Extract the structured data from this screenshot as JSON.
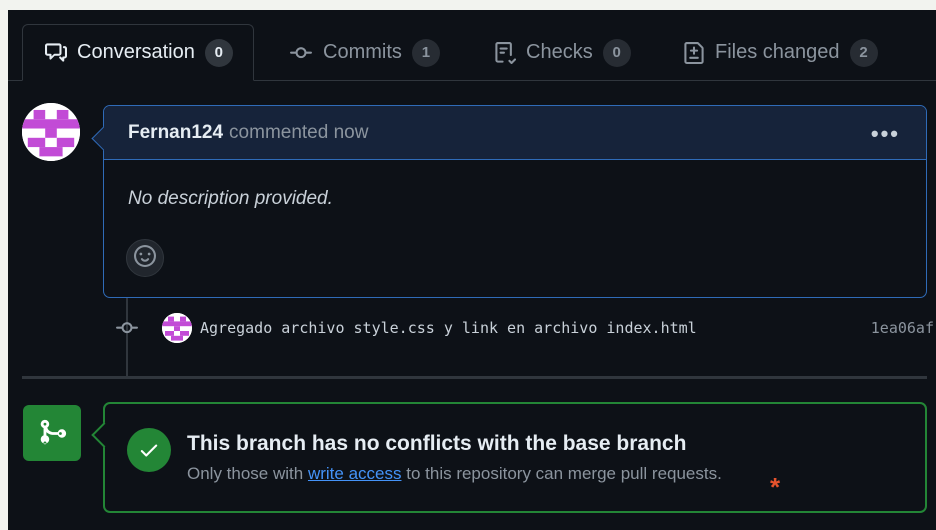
{
  "tabs": [
    {
      "label": "Conversation",
      "count": "0",
      "icon": "comment-discussion-icon"
    },
    {
      "label": "Commits",
      "count": "1",
      "icon": "git-commit-icon"
    },
    {
      "label": "Checks",
      "count": "0",
      "icon": "checklist-icon"
    },
    {
      "label": "Files changed",
      "count": "2",
      "icon": "file-diff-icon"
    }
  ],
  "comment": {
    "author": "Fernan124",
    "action": "commented now",
    "body": "No description provided.",
    "menu_icon": "kebab-horizontal-icon",
    "reaction_icon": "smiley-icon"
  },
  "commit": {
    "message": "Agregado archivo style.css y link en archivo index.html",
    "sha": "1ea06af"
  },
  "merge": {
    "title": "This branch has no conflicts with the base branch",
    "sub_before": "Only those with",
    "sub_link": "write access",
    "sub_after": "to this repository can merge pull requests.",
    "annotation": "*"
  },
  "colors": {
    "background": "#0d1117",
    "border": "#30363d",
    "accent_blue": "#2f6bb8",
    "success_green": "#238636",
    "link": "#4493f8",
    "avatar_purple": "#c24bd6"
  }
}
